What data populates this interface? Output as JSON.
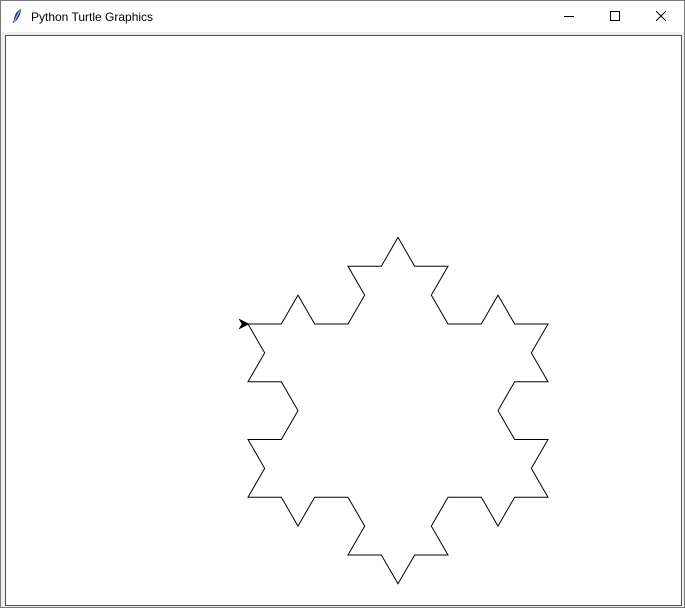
{
  "window": {
    "title": "Python Turtle Graphics",
    "icon": "feather-icon",
    "controls": {
      "minimize": "minimize-icon",
      "maximize": "maximize-icon",
      "close": "close-icon"
    }
  },
  "canvas": {
    "background": "#ffffff",
    "stroke_color": "#000000",
    "shape": "koch-snowflake",
    "turtle_icon": "turtle-arrow-icon"
  }
}
